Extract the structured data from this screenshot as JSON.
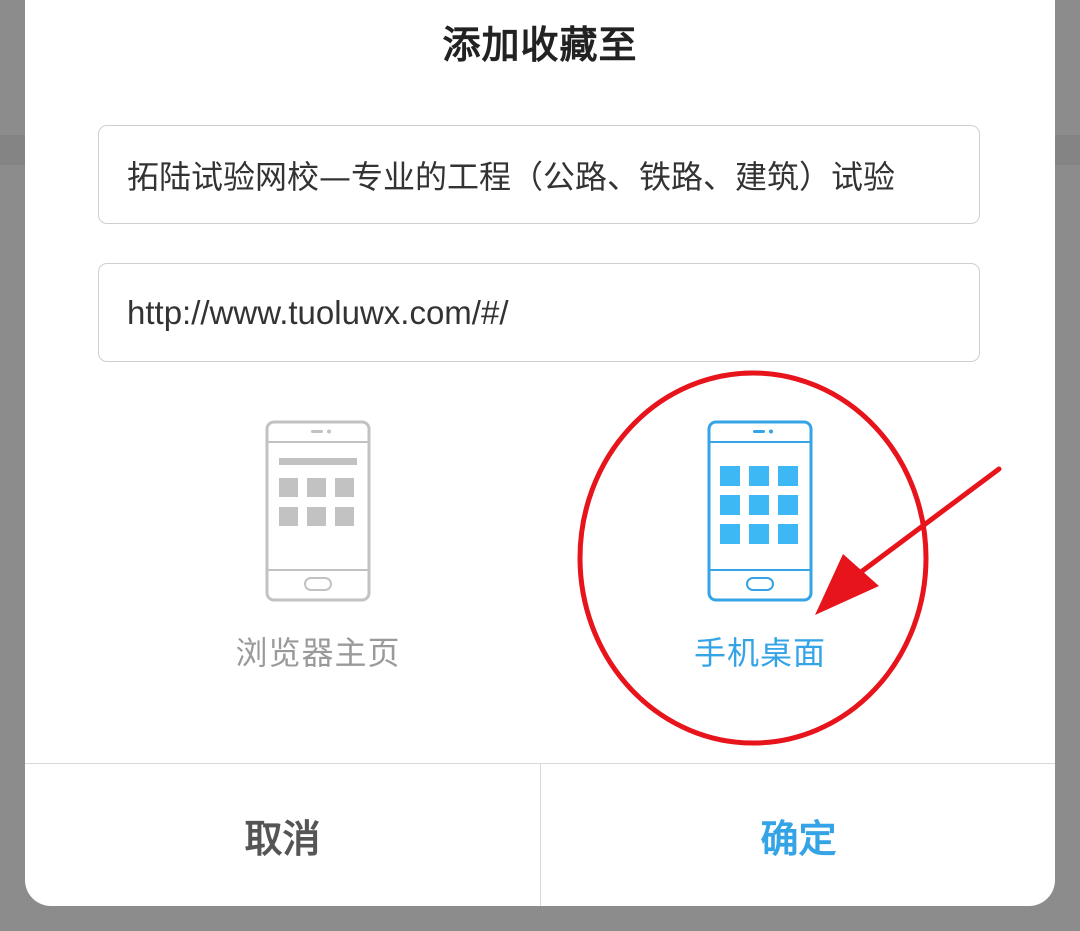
{
  "dialog": {
    "title": "添加收藏至",
    "name_field": {
      "value": "拓陆试验网校—专业的工程（公路、铁路、建筑）试验"
    },
    "url_field": {
      "value": "http://www.tuoluwx.com/#/"
    },
    "options": [
      {
        "label": "浏览器主页",
        "icon": "phone-browser-home-icon",
        "selected": false
      },
      {
        "label": "手机桌面",
        "icon": "phone-desktop-icon",
        "selected": true
      }
    ],
    "buttons": {
      "cancel": "取消",
      "ok": "确定"
    }
  },
  "colors": {
    "accent": "#35a4e6",
    "inactive": "#b5b5b5",
    "annotation": "#e8141b"
  }
}
